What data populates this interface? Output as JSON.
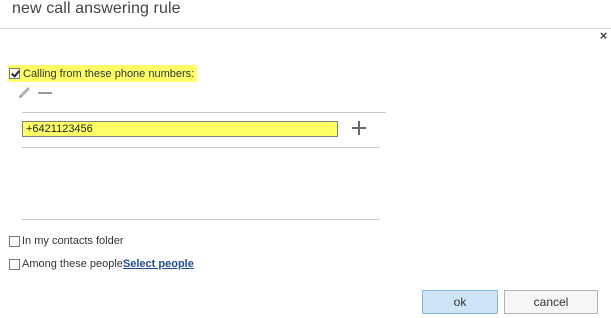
{
  "dialog": {
    "title": "new call answering rule",
    "close_glyph": "×"
  },
  "calling": {
    "label": "Calling from these phone numbers:",
    "checked": true
  },
  "toolbar": {
    "edit_icon": "pencil-icon",
    "remove_icon": "minus-icon",
    "add_icon": "plus-icon"
  },
  "phone_numbers": [
    "+6421123456"
  ],
  "options": {
    "contacts_label": "In my contacts folder",
    "people_label": "Among these people",
    "select_people_link": "Select people"
  },
  "buttons": {
    "ok": "ok",
    "cancel": "cancel"
  },
  "colors": {
    "highlight": "#ffff66",
    "ok_bg": "#cde6f7",
    "link": "#1f4e8c"
  }
}
